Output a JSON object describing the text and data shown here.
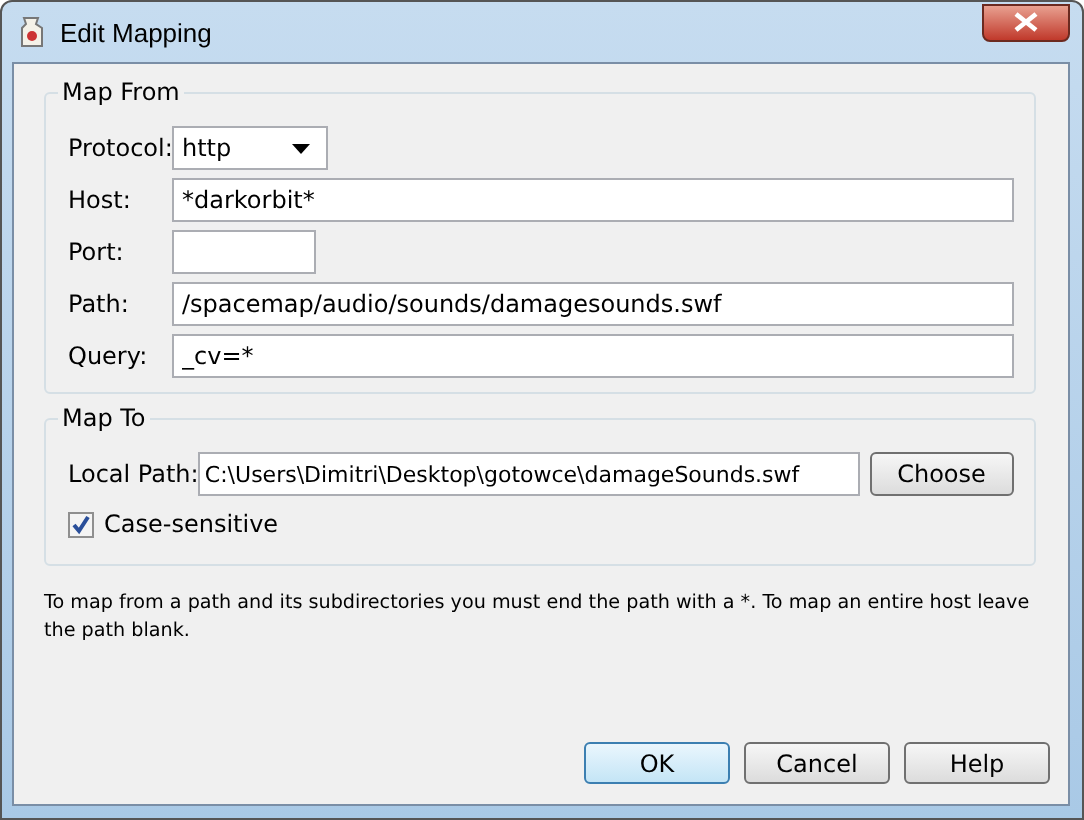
{
  "window": {
    "title": "Edit Mapping"
  },
  "map_from": {
    "title": "Map From",
    "fields": [
      {
        "kind": "dropdown",
        "label": "Protocol:",
        "value": "http"
      },
      {
        "kind": "text",
        "label": "Host:",
        "value": "*darkorbit*"
      },
      {
        "kind": "short",
        "label": "Port:"
      },
      {
        "kind": "text",
        "label": "Path:",
        "value": "/spacemap/audio/sounds/damagesounds.swf"
      },
      {
        "kind": "text",
        "label": "Query:",
        "value": "_cv=*"
      }
    ]
  },
  "map_to": {
    "title": "Map To",
    "local_path_label": "Local Path:",
    "local_path": "C:\\Users\\Dimitri\\Desktop\\gotowce\\damageSounds.swf",
    "choose_button": "Choose",
    "case_sensitive": {
      "label": "Case-sensitive",
      "checked": true
    }
  },
  "note": "To map from a path and its subdirectories you must end the path with a *. To map an entire host leave the path blank.",
  "buttons": [
    {
      "label": "OK",
      "default": true
    },
    {
      "label": "Cancel",
      "default": false
    },
    {
      "label": "Help",
      "default": false
    }
  ]
}
